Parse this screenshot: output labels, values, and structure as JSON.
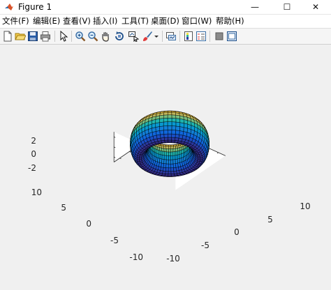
{
  "window": {
    "title": "Figure 1",
    "buttons": {
      "minimize": "—",
      "maximize": "☐",
      "close": "✕"
    }
  },
  "menu": [
    {
      "label": "文件(F)"
    },
    {
      "label": "编辑(E)"
    },
    {
      "label": "查看(V)"
    },
    {
      "label": "插入(I)"
    },
    {
      "label": "工具(T)"
    },
    {
      "label": "桌面(D)"
    },
    {
      "label": "窗口(W)"
    },
    {
      "label": "帮助(H)"
    }
  ],
  "toolbar": [
    "new-figure-icon",
    "open-file-icon",
    "save-icon",
    "print-icon",
    "edit-plot-arrow-icon",
    "zoom-in-icon",
    "zoom-out-icon",
    "pan-icon",
    "rotate-3d-icon",
    "data-cursor-icon",
    "brush-icon",
    "brush-dropdown-icon",
    "link-plot-icon",
    "colorbar-icon",
    "legend-icon",
    "hide-plot-tools-icon",
    "show-plot-tools-icon"
  ],
  "axes": {
    "z_ticks": [
      "2",
      "0",
      "-2"
    ],
    "y_ticks": [
      "10",
      "5",
      "0",
      "-5",
      "-10"
    ],
    "x_ticks": [
      "-10",
      "-5",
      "0",
      "5",
      "10"
    ]
  },
  "chart_data": {
    "type": "surface",
    "surface": "torus",
    "major_radius": 10,
    "minor_radius": 3,
    "colormap": "parula",
    "xlim": [
      -13,
      13
    ],
    "ylim": [
      -13,
      13
    ],
    "zlim": [
      -3,
      3
    ],
    "grid": false,
    "colors": {
      "background": "#f0f0f0",
      "axes_face": "#ffffff",
      "edge": "#000000"
    }
  }
}
